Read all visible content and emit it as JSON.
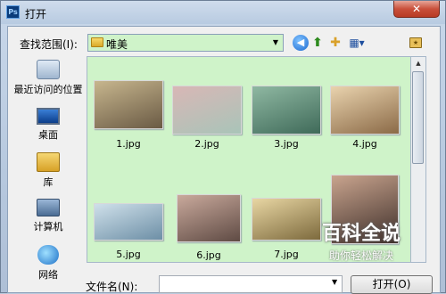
{
  "window": {
    "title": "打开",
    "app_icon": "Ps",
    "close_label": "✕"
  },
  "lookin": {
    "label": "查找范围(I):",
    "value": "唯美"
  },
  "toolbar": {
    "back": "back-icon",
    "up": "up-folder-icon",
    "new_folder": "new-folder-icon",
    "views": "view-menu-icon"
  },
  "places": [
    {
      "label": "最近访问的位置"
    },
    {
      "label": "桌面"
    },
    {
      "label": "库"
    },
    {
      "label": "计算机"
    },
    {
      "label": "网络"
    }
  ],
  "files": [
    {
      "name": "1.jpg",
      "colors": [
        "#c7b68e",
        "#6a5a44"
      ]
    },
    {
      "name": "2.jpg",
      "colors": [
        "#d8b7b6",
        "#a9c4b8"
      ]
    },
    {
      "name": "3.jpg",
      "colors": [
        "#8fb8a2",
        "#3f6a59"
      ]
    },
    {
      "name": "4.jpg",
      "colors": [
        "#e9d3ae",
        "#8b6a47"
      ]
    },
    {
      "name": "5.jpg",
      "colors": [
        "#cfe0ea",
        "#6d8fa6"
      ]
    },
    {
      "name": "6.jpg",
      "colors": [
        "#c9a99c",
        "#5f4b44"
      ]
    },
    {
      "name": "7.jpg",
      "colors": [
        "#e8d6a3",
        "#7d6a3d"
      ]
    },
    {
      "name": "",
      "colors": [
        "#c9a48e",
        "#3e2f2a"
      ]
    }
  ],
  "filename": {
    "label": "文件名(N):",
    "value": ""
  },
  "open_button": "打开(O)",
  "watermark": {
    "main": "百科全说",
    "sub": "助你轻松解决"
  },
  "colors": {
    "pane_bg": "#cff3c9",
    "titlebar": "#b8cbe1"
  }
}
